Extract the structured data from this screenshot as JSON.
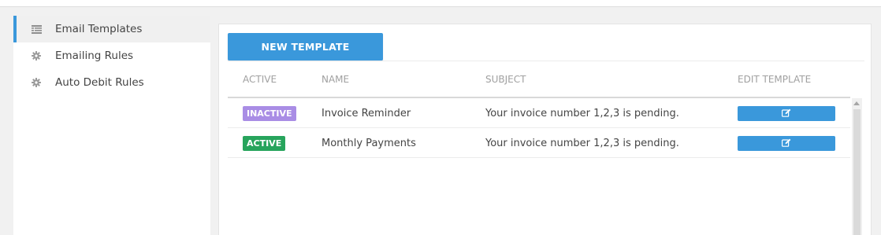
{
  "sidebar": {
    "items": [
      {
        "label": "Email Templates",
        "icon": "list-icon",
        "active": true
      },
      {
        "label": "Emailing Rules",
        "icon": "gear-icon",
        "active": false
      },
      {
        "label": "Auto Debit Rules",
        "icon": "gear-icon",
        "active": false
      }
    ]
  },
  "toolbar": {
    "new_template_label": "NEW TEMPLATE"
  },
  "table": {
    "columns": [
      "ACTIVE",
      "NAME",
      "SUBJECT",
      "EDIT TEMPLATE"
    ],
    "rows": [
      {
        "status": "INACTIVE",
        "status_color": "#a98de5",
        "name": "Invoice Reminder",
        "subject": "Your invoice number 1,2,3 is pending.",
        "edit_icon": "edit-icon"
      },
      {
        "status": "ACTIVE",
        "status_color": "#27a45c",
        "name": "Monthly Payments",
        "subject": "Your invoice number 1,2,3 is pending.",
        "edit_icon": "edit-icon"
      }
    ]
  },
  "colors": {
    "accent": "#3a98db",
    "inactive_badge": "#a98de5",
    "active_badge": "#27a45c"
  }
}
